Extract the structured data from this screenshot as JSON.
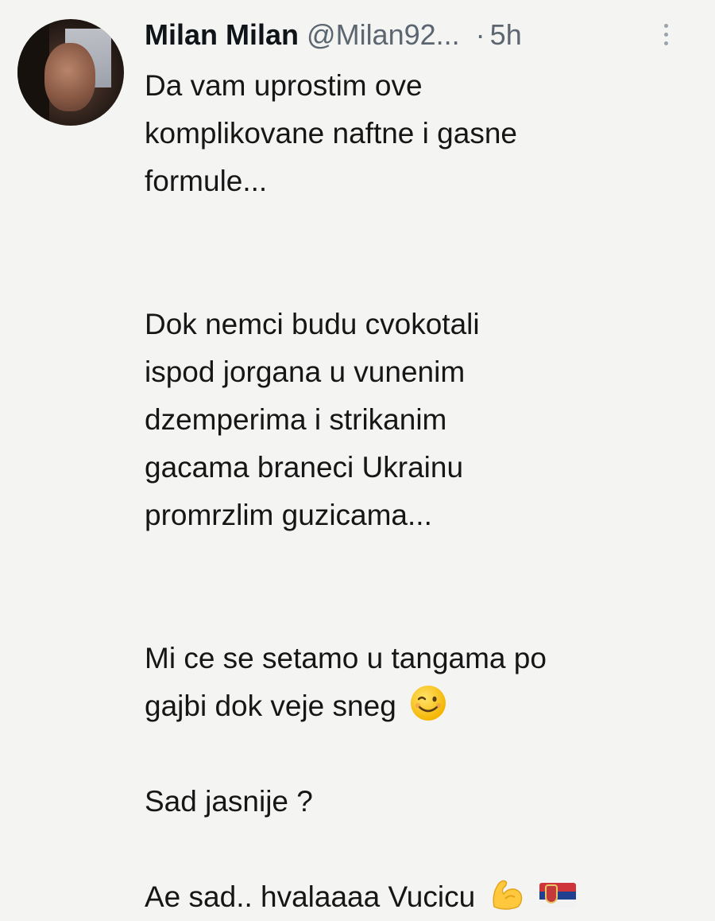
{
  "tweet": {
    "author_name": "Milan Milan",
    "handle": "@Milan92...",
    "separator": "·",
    "time": "5h",
    "lines": {
      "p1_l1": "Da vam uprostim ove",
      "p1_l2": "komplikovane naftne i gasne",
      "p1_l3": "formule...",
      "p2_l1": "Dok nemci budu cvokotali",
      "p2_l2": "ispod jorgana u vunenim",
      "p2_l3": "dzemperima i strikanim",
      "p2_l4": "gacama braneci Ukrainu",
      "p2_l5": "promrzlim guzicama...",
      "p3_l1": "Mi ce se setamo u tangama po",
      "p3_l2": "gajbi dok veje sneg",
      "p4_l1": "Sad jasnije ?",
      "p5_l1": "Ae sad.. hvalaaaa Vucicu"
    }
  },
  "icons": {
    "more": "more-options-icon",
    "wink": "winking-face-emoji",
    "muscle": "flexed-biceps-emoji",
    "flag": "serbia-flag-emoji"
  },
  "colors": {
    "background": "#f4f4f3",
    "text": "#161616",
    "secondary": "#5b6670"
  }
}
